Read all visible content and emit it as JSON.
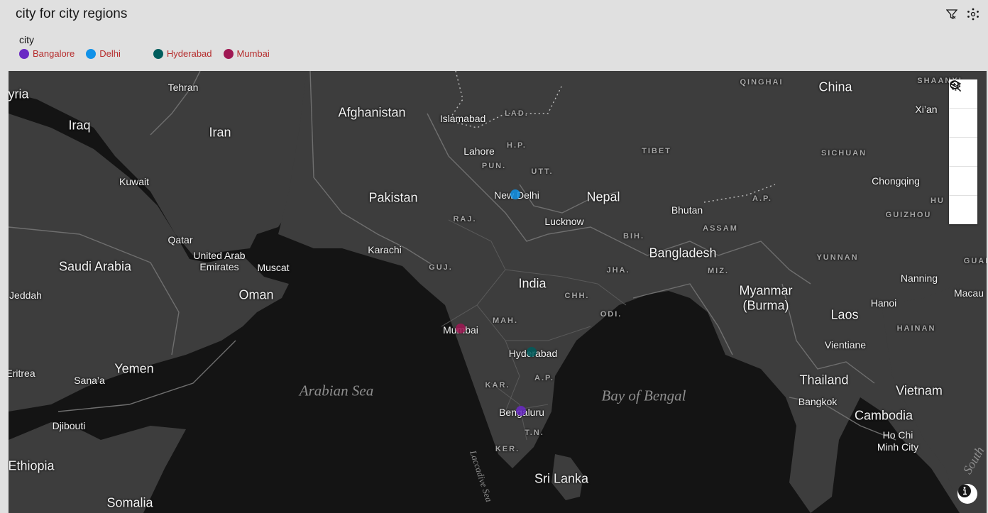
{
  "header": {
    "title": "city for city regions"
  },
  "toolbar": {
    "filter_icon": "filter-icon",
    "settings_icon": "network-settings-icon"
  },
  "legend": {
    "title": "city",
    "items": [
      {
        "label": "Bangalore",
        "color": "#6929c4"
      },
      {
        "label": "Delhi",
        "color": "#1192e8"
      },
      {
        "label": "Hyderabad",
        "color": "#005d5d"
      },
      {
        "label": "Mumbai",
        "color": "#9f1853"
      }
    ]
  },
  "map": {
    "countries": [
      "Afghanistan",
      "Iraq",
      "Iran",
      "Pakistan",
      "Nepal",
      "Saudi Arabia",
      "Oman",
      "India",
      "Bangladesh",
      "Myanmar",
      "(Burma)",
      "Laos",
      "Thailand",
      "Vietnam",
      "Cambodia",
      "Yemen",
      "Ethiopia",
      "Somalia",
      "China",
      "Sri Lanka",
      "Bhutan",
      "Qatar",
      "United Arab",
      "Emirates"
    ],
    "cities": [
      "Tehran",
      "Kuwait",
      "Islamabad",
      "Lahore",
      "New Delhi",
      "Lucknow",
      "Karachi",
      "Mumbai",
      "Hyderabad",
      "Bengaluru",
      "Muscat",
      "Jeddah",
      "Sana’a",
      "Djibouti",
      "Xi’an",
      "Chongqing",
      "Nanning",
      "Hanoi",
      "Vientiane",
      "Bangkok",
      "Ho Chi",
      "Minh City",
      "Macau",
      "Eritrea",
      "yria"
    ],
    "regions": [
      "LAD.",
      "H.P.",
      "PUN.",
      "UTT.",
      "RAJ.",
      "GUJ.",
      "MAH.",
      "CHH.",
      "JHA.",
      "ODI.",
      "BIH.",
      "ASSAM",
      "MIZ.",
      "A.P.",
      "KAR.",
      "T.N.",
      "KER.",
      "QINGHAI",
      "TIBET",
      "SICHUAN",
      "YUNNAN",
      "GUIZHOU",
      "HAINAN",
      "SHAANXI",
      "GUAN",
      "HU",
      "A.P."
    ],
    "seas": [
      "Arabian Sea",
      "Bay of Bengal",
      "Laccadive Sea",
      "South"
    ],
    "markers": [
      "Delhi",
      "Mumbai",
      "Hyderabad",
      "Bangalore"
    ]
  },
  "controls": [
    "layers-icon",
    "zoom-in-icon",
    "zoom-out-icon",
    "reset-icon",
    "search-icon"
  ],
  "info_icon": "info-icon"
}
